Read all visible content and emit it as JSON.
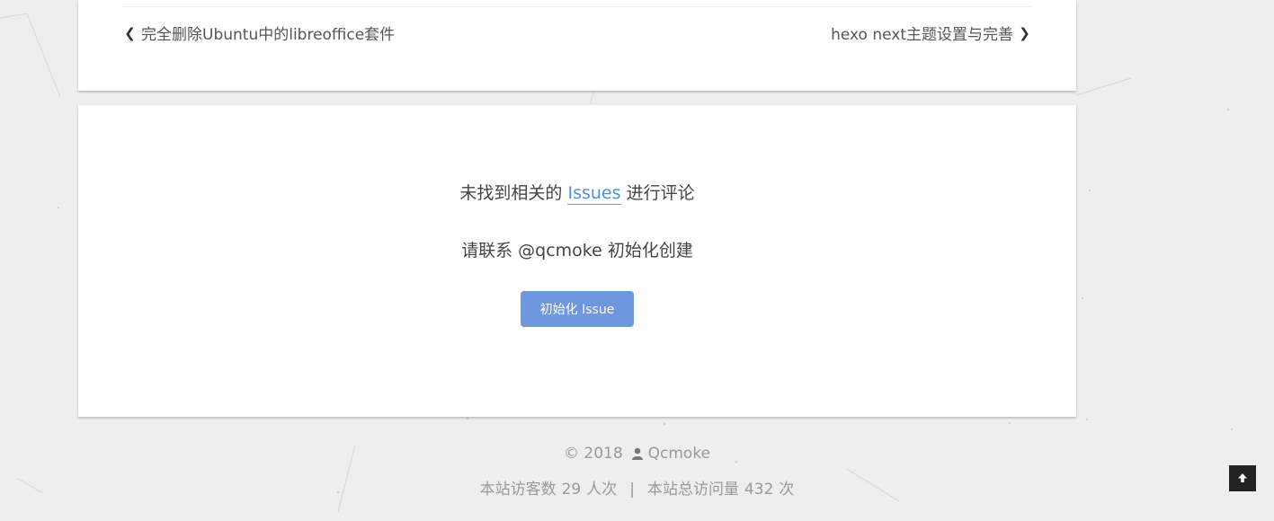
{
  "post_nav": {
    "prev_label": "完全删除Ubuntu中的libreoffice套件",
    "next_label": "hexo next主题设置与完善"
  },
  "comments": {
    "not_found_prefix": "未找到相关的",
    "issues_link": "Issues",
    "not_found_suffix": "进行评论",
    "contact_prefix": "请联系",
    "owner": "@qcmoke",
    "contact_suffix": "初始化创建",
    "init_button": "初始化 Issue"
  },
  "footer": {
    "copyright": "© 2018",
    "author": "Qcmoke",
    "visitors_prefix": "本站访客数",
    "visitors_count": "29",
    "visitors_suffix": "人次",
    "separator": "|",
    "views_prefix": "本站总访问量",
    "views_count": "432",
    "views_suffix": "次"
  },
  "icons": {
    "prev": "chevron-left-icon",
    "next": "chevron-right-icon",
    "author": "user-icon",
    "back_to_top": "arrow-up-icon"
  }
}
